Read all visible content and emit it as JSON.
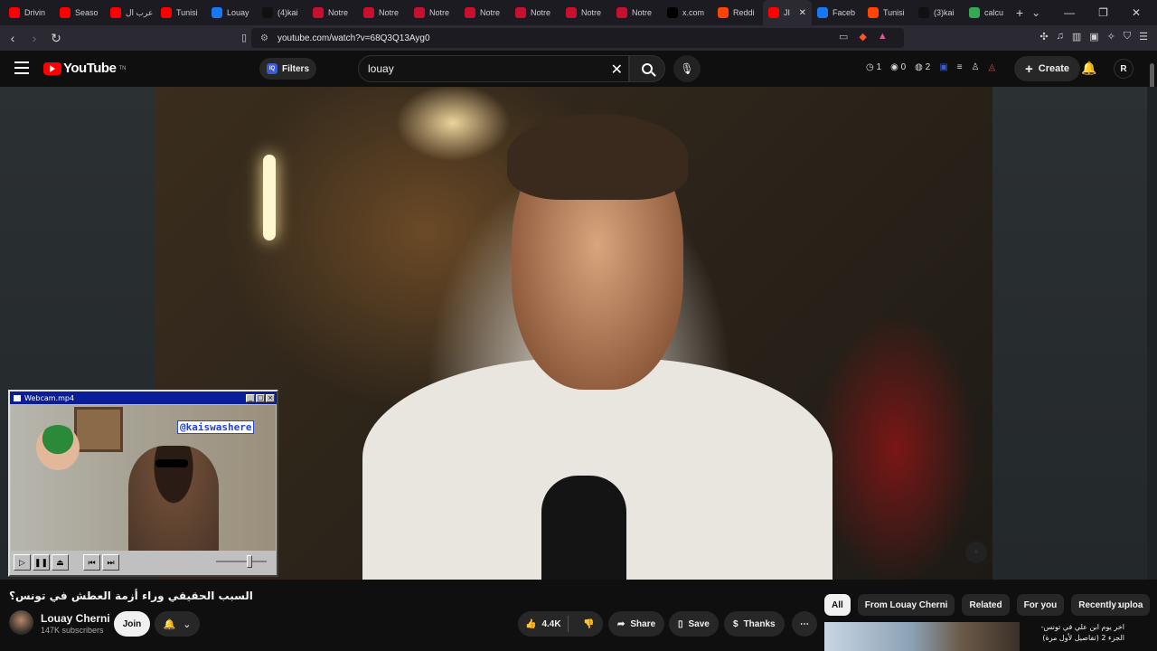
{
  "browser": {
    "tabs": [
      {
        "label": "Drivin",
        "icon": "youtube-icon",
        "color": "#ff0000"
      },
      {
        "label": "Seaso",
        "icon": "youtube-icon",
        "color": "#ff0000"
      },
      {
        "label": "عرب ال",
        "icon": "youtube-icon",
        "color": "#ff0000"
      },
      {
        "label": "Tunisi",
        "icon": "youtube-icon",
        "color": "#ff0000"
      },
      {
        "label": "Louay",
        "icon": "facebook-icon",
        "color": "#1877f2"
      },
      {
        "label": "(4)kai",
        "icon": "tiktok-icon",
        "color": "#111111"
      },
      {
        "label": "Notre",
        "icon": "n-icon",
        "color": "#c8102e"
      },
      {
        "label": "Notre",
        "icon": "n-icon",
        "color": "#c8102e"
      },
      {
        "label": "Notre",
        "icon": "n-icon",
        "color": "#c8102e"
      },
      {
        "label": "Notre",
        "icon": "n-icon",
        "color": "#c8102e"
      },
      {
        "label": "Notre",
        "icon": "n-icon",
        "color": "#c8102e"
      },
      {
        "label": "Notre",
        "icon": "n-icon",
        "color": "#c8102e"
      },
      {
        "label": "Notre",
        "icon": "n-icon",
        "color": "#c8102e"
      },
      {
        "label": "x.com",
        "icon": "x-icon",
        "color": "#000000"
      },
      {
        "label": "Reddi",
        "icon": "reddit-icon",
        "color": "#ff4500"
      },
      {
        "label": "JI",
        "icon": "youtube-icon",
        "color": "#ff0000",
        "active": true
      },
      {
        "label": "Faceb",
        "icon": "facebook-icon",
        "color": "#1877f2"
      },
      {
        "label": "Tunisi",
        "icon": "reddit-icon",
        "color": "#ff4500"
      },
      {
        "label": "(3)kai",
        "icon": "tiktok-icon",
        "color": "#111111"
      },
      {
        "label": "calcu",
        "icon": "google-icon",
        "color": "#34a853"
      }
    ],
    "url": "youtube.com/watch?v=68Q3Q13Ayg0"
  },
  "youtube": {
    "logo_text": "YouTube",
    "logo_suffix": "TN",
    "filters_label": "Filters",
    "search_value": "louay",
    "stats": {
      "a": "1",
      "b": "0",
      "c": "2"
    },
    "create_label": "Create",
    "avatar_letter": "R"
  },
  "webcam": {
    "title": "Webcam.mp4",
    "overlay_tag": "@kaiswashere"
  },
  "video": {
    "title": "السبب الحقيقي وراء أزمة العطش في تونس؟",
    "channel": "Louay Cherni",
    "subscribers": "147K subscribers",
    "join_label": "Join",
    "likes": "4.4K",
    "share_label": "Share",
    "save_label": "Save",
    "thanks_label": "Thanks"
  },
  "recommendations": {
    "chips": [
      "All",
      "From Louay Cherni",
      "Related",
      "For you",
      "Recently uploa"
    ],
    "first_title": "اخر يوم ابن علي في تونس- الجزء 2 (تفاصيل لأول مرة)"
  }
}
